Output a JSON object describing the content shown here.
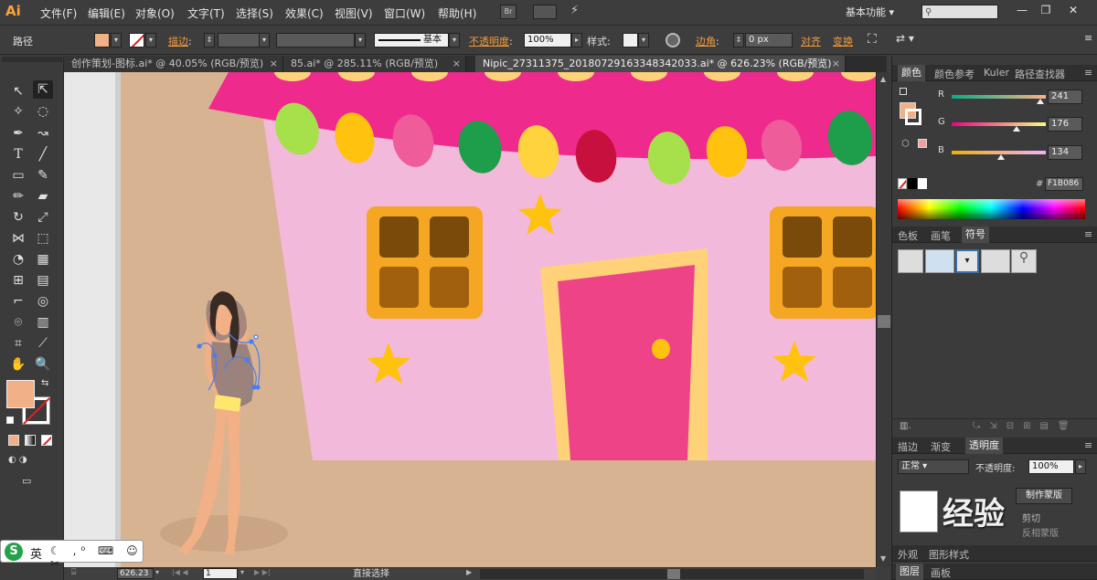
{
  "app": {
    "logo": "Ai",
    "menu": [
      "文件(F)",
      "编辑(E)",
      "对象(O)",
      "文字(T)",
      "选择(S)",
      "效果(C)",
      "视图(V)",
      "窗口(W)",
      "帮助(H)"
    ],
    "bridge_label": "Br",
    "workspace": "基本功能",
    "window_buttons": [
      "—",
      "❐",
      "✕"
    ]
  },
  "control": {
    "object_type": "路径",
    "stroke_label": "描边",
    "stroke_style": "基本",
    "opacity_label": "不透明度",
    "opacity_value": "100%",
    "style_label": "样式",
    "corner_label": "边角",
    "corner_value": "0 px",
    "align_label": "对齐",
    "transform_label": "变换"
  },
  "tabs": [
    {
      "label": "创作策划-图标.ai* @ 40.05% (RGB/预览)",
      "close": "×"
    },
    {
      "label": "85.ai* @ 285.11% (RGB/预览)",
      "close": "×"
    },
    {
      "label": "Nipic_27311375_20180729163348342033.ai* @ 626.23% (RGB/预览)",
      "close": "×"
    }
  ],
  "color_panel": {
    "tabs": [
      "颜色",
      "颜色参考",
      "Kuler",
      "路径查找器"
    ],
    "channels": [
      {
        "label": "R",
        "value": "241",
        "fraction": 0.945
      },
      {
        "label": "G",
        "value": "176",
        "fraction": 0.69
      },
      {
        "label": "B",
        "value": "134",
        "fraction": 0.525
      }
    ],
    "hex_label": "#",
    "hex": "F1B086"
  },
  "symbols_panel": {
    "tabs": [
      "色板",
      "画笔",
      "符号"
    ]
  },
  "transparency_panel": {
    "tabs": [
      "描边",
      "渐变",
      "透明度"
    ],
    "blend_mode": "正常",
    "opacity_label": "不透明度",
    "opacity_value": "100%",
    "mask_button": "制作蒙版",
    "clip_label": "剪切",
    "invert_label": "反相蒙版"
  },
  "appearance_panel": {
    "tabs": [
      "外观",
      "图形样式"
    ]
  },
  "layers_panel": {
    "tabs": [
      "图层",
      "画板"
    ]
  },
  "status": {
    "zoom": "626.23",
    "artboard": "1",
    "tool_name": "直接选择"
  },
  "ime": {
    "lang": "英"
  },
  "watermark": "经验",
  "colors": {
    "fill": "#F1B086",
    "roof": "#EE2A8C",
    "wall": "#F2B9DA",
    "window": "#F5A623",
    "pane": "#7A4A0A",
    "door": "#EE4487",
    "door_frame": "#FFD27A",
    "star": "#FFC20E"
  }
}
